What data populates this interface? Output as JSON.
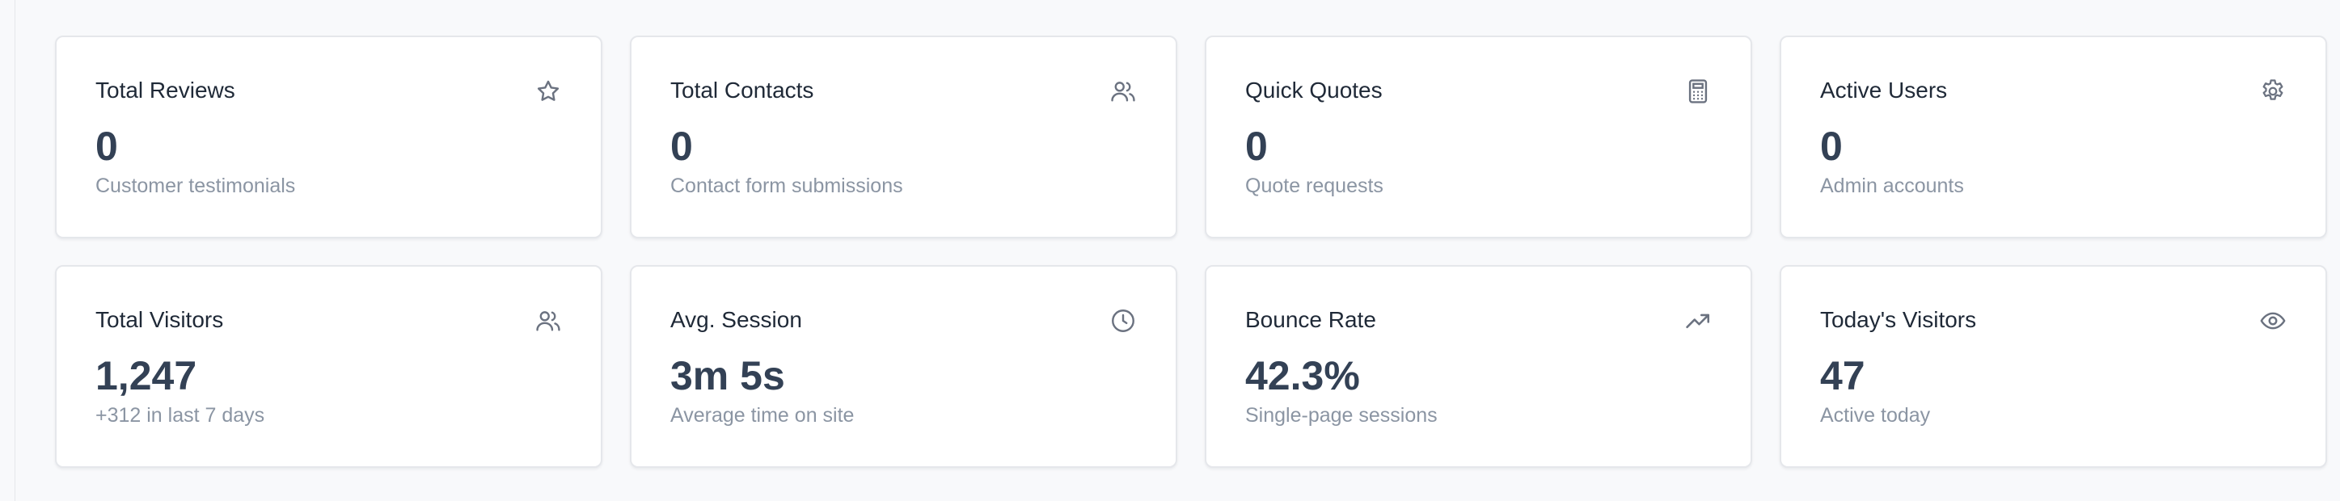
{
  "cards": [
    {
      "title": "Total Reviews",
      "value": "0",
      "subtitle": "Customer testimonials",
      "icon": "star-icon"
    },
    {
      "title": "Total Contacts",
      "value": "0",
      "subtitle": "Contact form submissions",
      "icon": "users-icon"
    },
    {
      "title": "Quick Quotes",
      "value": "0",
      "subtitle": "Quote requests",
      "icon": "calculator-icon"
    },
    {
      "title": "Active Users",
      "value": "0",
      "subtitle": "Admin accounts",
      "icon": "gear-icon"
    },
    {
      "title": "Total Visitors",
      "value": "1,247",
      "subtitle": "+312 in last 7 days",
      "icon": "users-icon"
    },
    {
      "title": "Avg. Session",
      "value": "3m 5s",
      "subtitle": "Average time on site",
      "icon": "clock-icon"
    },
    {
      "title": "Bounce Rate",
      "value": "42.3%",
      "subtitle": "Single-page sessions",
      "icon": "trending-up-icon"
    },
    {
      "title": "Today's Visitors",
      "value": "47",
      "subtitle": "Active today",
      "icon": "eye-icon"
    }
  ],
  "colors": {
    "background": "#f8f9fb",
    "card": "#ffffff",
    "border": "#e5e7eb",
    "title": "#1f2937",
    "value": "#334155",
    "subtitle": "#8b95a3",
    "icon": "#6b7280"
  }
}
